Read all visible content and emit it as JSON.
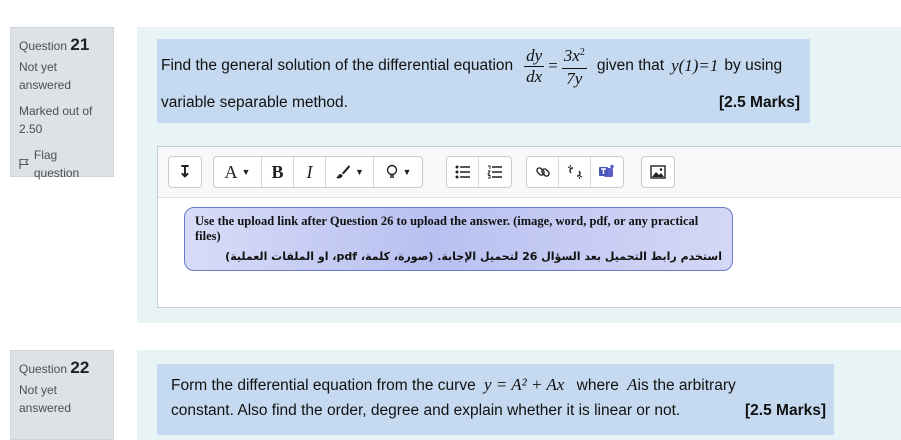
{
  "q21": {
    "label": "Question",
    "number": "21",
    "state": "Not yet answered",
    "grade": "Marked out of 2.50",
    "flag": "Flag question",
    "text_before": "Find the general solution of the differential equation",
    "frac1_num": "dy",
    "frac1_den": "dx",
    "equals": "=",
    "frac2_num": "3x",
    "frac2_exp": "2",
    "frac2_den": "7y",
    "text_middle": "given that",
    "condition": "y(1)=1",
    "text_after": "by using",
    "line2": "variable separable method.",
    "marks": "[2.5 Marks]"
  },
  "editor": {
    "callout_en": "Use the upload link after Question 26 to upload the answer. (image, word, pdf, or any practical files)",
    "callout_ar": "استخدم رابط التحميل بعد السؤال 26 لتحميل الإجابة. (صورة، كلمة، pdf، او الملفات العملية)",
    "buttons": {
      "collapse": "↧",
      "font": "A",
      "bold": "B",
      "italic": "I",
      "brush": "🖌",
      "bulb": "♀"
    }
  },
  "q22": {
    "label": "Question",
    "number": "22",
    "state": "Not yet answered",
    "text_before": "Form the differential equation from the curve",
    "equation": "y = A² + Ax",
    "text_where": "where",
    "var": "A",
    "text_after": "is the arbitrary",
    "line2": "constant. Also find the order, degree and explain whether it is linear or not.",
    "marks": "[2.5 Marks]"
  }
}
